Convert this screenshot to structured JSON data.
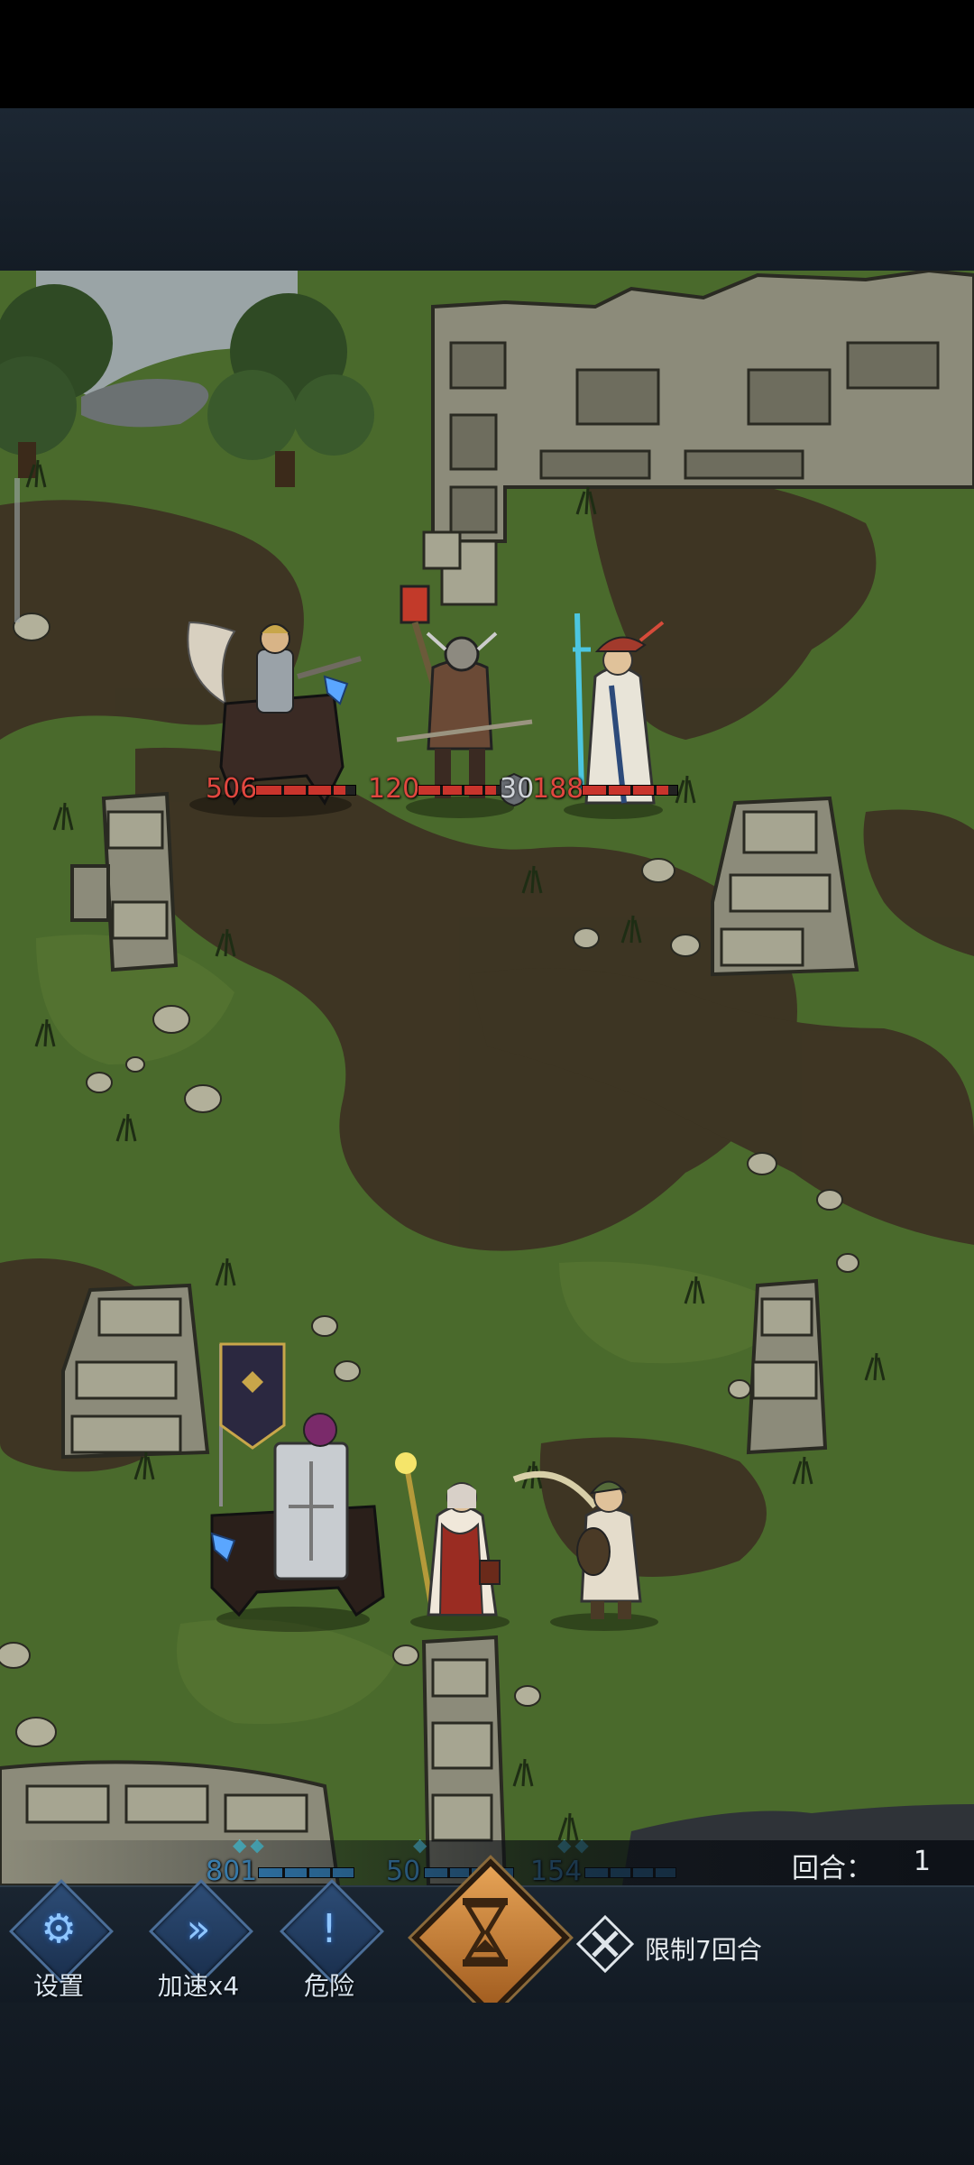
{
  "battle": {
    "enemies": [
      {
        "name": "winged-hussar",
        "hp": "506",
        "hp_fill": 0.9
      },
      {
        "name": "hammer-warrior",
        "hp": "120",
        "hp_fill": 0.9
      },
      {
        "name": "white-robed-mage",
        "hp": "188",
        "hp_fill": 0.9,
        "shield": "30"
      }
    ],
    "allies": [
      {
        "name": "banner-knight",
        "hp": "801",
        "hp_fill": 1.0,
        "pips": "◆◆"
      },
      {
        "name": "priest",
        "hp": "50",
        "hp_fill": 1.0,
        "pips": "◆"
      },
      {
        "name": "bard",
        "hp": "154",
        "hp_fill": 1.0,
        "pips": "◆◆"
      }
    ]
  },
  "round": {
    "label": "回合：",
    "value": "1"
  },
  "toolbar": {
    "settings_label": "设置",
    "speed_label": "加速x4",
    "danger_label": "危险",
    "limit_text": "限制7回合"
  },
  "icons": {
    "settings": "gears-icon",
    "speed": "double-chevron-icon",
    "danger": "exclamation-icon",
    "end_turn": "hourglass-icon",
    "limit": "crossed-swords-icon"
  },
  "colors": {
    "enemy_hp": "#c9342c",
    "ally_hp": "#3d9be0",
    "accent_orange": "#d88a3c"
  }
}
